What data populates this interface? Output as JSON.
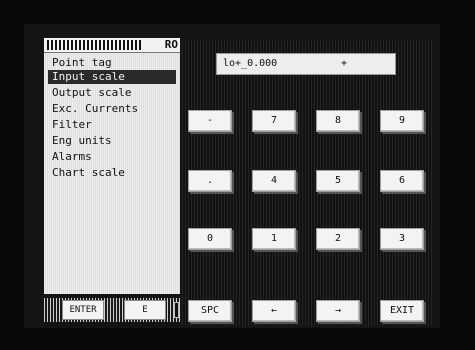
{
  "menu": {
    "code": "RO",
    "items": [
      {
        "label": "Point tag"
      },
      {
        "label": "Input scale"
      },
      {
        "label": "Output scale"
      },
      {
        "label": "Exc. Currents"
      },
      {
        "label": "Filter"
      },
      {
        "label": "Eng units"
      },
      {
        "label": "Alarms"
      },
      {
        "label": "Chart scale"
      }
    ]
  },
  "entry": {
    "value": "lo+_0.000",
    "cursor": "+"
  },
  "keypad": {
    "rows": [
      [
        "-",
        "7",
        "8",
        "9"
      ],
      [
        ".",
        "4",
        "5",
        "6"
      ],
      [
        "0",
        "1",
        "2",
        "3"
      ],
      [
        "SPC",
        "←",
        "→",
        "EXIT"
      ]
    ]
  },
  "softkeys": {
    "enter": "ENTER",
    "e": "E"
  }
}
